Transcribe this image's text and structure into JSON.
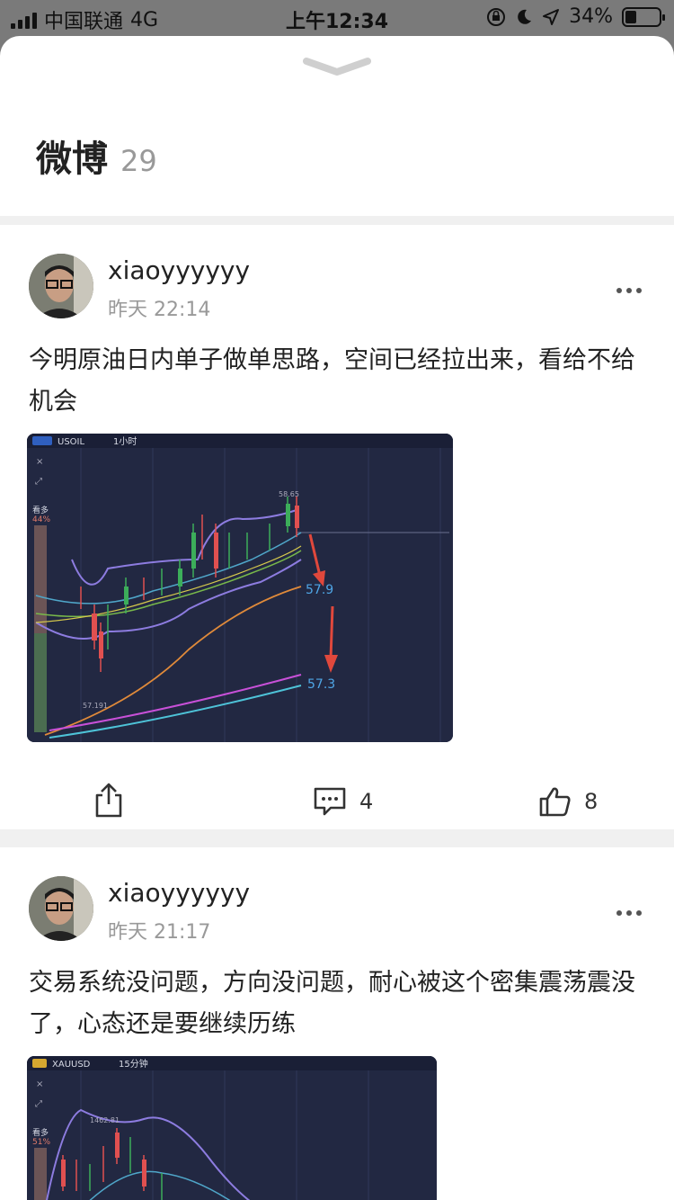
{
  "status_bar": {
    "carrier": "中国联通",
    "network": "4G",
    "time": "上午12:34",
    "battery": "34%",
    "battery_level": 0.34
  },
  "sheet": {
    "title": "微博",
    "count": "29"
  },
  "posts": [
    {
      "username": "xiaoyyyyyy",
      "time": "昨天 22:14",
      "text": "今明原油日内单子做单思路，空间已经拉出来，看给不给机会",
      "chart": {
        "symbol": "USOIL",
        "interval": "1小时",
        "high_label": "58.65",
        "low_label": "57.191",
        "target1": "57.9",
        "target2": "57.3",
        "side_label": "看多",
        "side_pct": "44%"
      },
      "comments": "4",
      "likes": "8"
    },
    {
      "username": "xiaoyyyyyy",
      "time": "昨天 21:17",
      "text": "交易系统没问题，方向没问题，耐心被这个密集震荡震没了，心态还是要继续历练",
      "chart": {
        "symbol": "XAUUSD",
        "interval": "15分钟",
        "high_label": "1462.81",
        "side_label": "看多",
        "side_pct": "51%"
      }
    }
  ],
  "icons": {
    "share": "share-icon",
    "comment": "comment-icon",
    "like": "thumbs-up-icon",
    "more": "more-icon",
    "collapse": "chevron-down-icon"
  }
}
